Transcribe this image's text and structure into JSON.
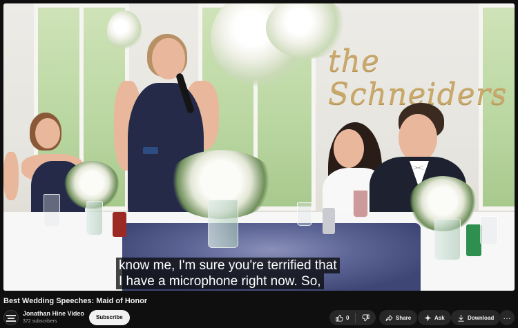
{
  "video": {
    "captions": [
      "know me, I'm sure you're terrified that",
      "I have a microphone right now. So,"
    ],
    "sign_text": "the Schneiders"
  },
  "info": {
    "title": "Best Wedding Speeches: Maid of Honor",
    "channel_name": "Jonathan Hine Video",
    "subscribers": "372 subscribers",
    "subscribe_label": "Subscribe"
  },
  "actions": {
    "like_count": "0",
    "share_label": "Share",
    "ask_label": "Ask",
    "download_label": "Download",
    "more_label": "…"
  },
  "icons": {
    "like": "thumbs-up-icon",
    "dislike": "thumbs-down-icon",
    "share": "share-arrow-icon",
    "ask": "sparkle-icon",
    "download": "download-icon",
    "more": "more-horizontal-icon"
  },
  "colors": {
    "background": "#0f0f0f",
    "button": "#272727",
    "subscribe_bg": "#f1f1f1",
    "text": "#f1f1f1",
    "subtext": "#aaaaaa"
  }
}
